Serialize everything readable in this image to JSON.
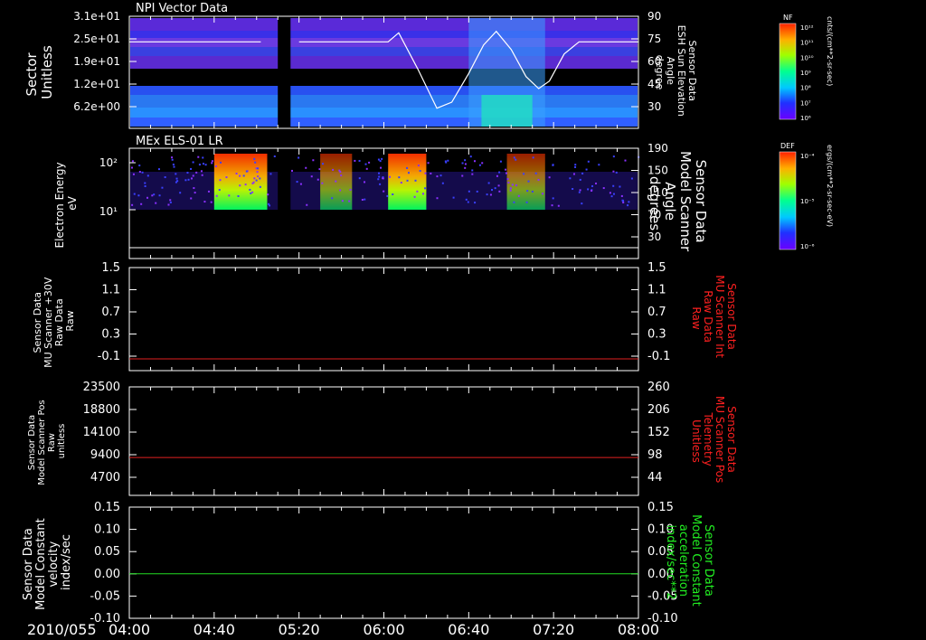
{
  "time_axis": {
    "date_label": "2010/055",
    "tick_labels": [
      "04:00",
      "04:40",
      "05:20",
      "06:00",
      "06:40",
      "07:20",
      "08:00"
    ],
    "range_minutes": [
      240,
      480
    ]
  },
  "panels": [
    {
      "id": "npi",
      "title": "NPI Vector Data",
      "left_label": [
        "Sector",
        "Unitless"
      ],
      "right_label": [
        "Sensor Data",
        "ESH Sun Elevation",
        "Angle",
        "degree"
      ],
      "left_ticks": [
        "3.1e+01",
        "2.5e+01",
        "1.9e+01",
        "1.2e+01",
        "6.2e+00"
      ],
      "right_ticks": [
        "90",
        "75",
        "60",
        "45",
        "30"
      ]
    },
    {
      "id": "els",
      "title": "MEx ELS-01 LR",
      "left_label": [
        "Electron Energy",
        "eV"
      ],
      "right_label": [
        "Sensor Data",
        "Model Scanner",
        "Angle",
        "degrees"
      ],
      "left_ticks": [
        "10²",
        "10¹"
      ],
      "right_ticks": [
        "190",
        "150",
        "110",
        "70",
        "30"
      ]
    },
    {
      "id": "scanner-int",
      "title": "",
      "left_label": [
        "Sensor Data",
        "MU Scanner +30V",
        "Raw Data",
        "Raw"
      ],
      "right_label": [
        "Sensor Data",
        "MU Scanner Int",
        "Raw Data",
        "Raw"
      ],
      "left_ticks": [
        "1.5",
        "1.1",
        "0.7",
        "0.3",
        "-0.1"
      ],
      "right_ticks": [
        "1.5",
        "1.1",
        "0.7",
        "0.3",
        "-0.1"
      ]
    },
    {
      "id": "scanner-pos",
      "title": "",
      "left_label": [
        "Sensor Data",
        "Model Scanner Pos",
        "Raw",
        "unitless"
      ],
      "right_label": [
        "Sensor Data",
        "MU Scanner Pos",
        "Telemetry",
        "Unitless"
      ],
      "left_ticks": [
        "23500",
        "18800",
        "14100",
        "9400",
        "4700"
      ],
      "right_ticks": [
        "260",
        "206",
        "152",
        "98",
        "44"
      ]
    },
    {
      "id": "velocity",
      "title": "",
      "left_label": [
        "Sensor Data",
        "Model Constant",
        "velocity",
        "index/sec"
      ],
      "right_label": [
        "Sensor Data",
        "Model Constant",
        "acceleration",
        "index/sec**2"
      ],
      "left_ticks": [
        "0.15",
        "0.10",
        "0.05",
        "0.00",
        "-0.05",
        "-0.10"
      ],
      "right_ticks": [
        "0.15",
        "0.10",
        "0.05",
        "0.00",
        "-0.05",
        "-0.10"
      ]
    }
  ],
  "colorbars": [
    {
      "id": "nf",
      "title": "NF",
      "unit": "cnts/(cm**2-sr-sec)",
      "ticks": [
        "10¹²",
        "10¹¹",
        "10¹⁰",
        "10⁹",
        "10⁸",
        "10⁷",
        "10⁶"
      ]
    },
    {
      "id": "def",
      "title": "DEF",
      "unit": "ergs/(cm**2-sr-sec-eV)",
      "ticks": [
        "10⁻⁴",
        "10⁻⁵",
        "10⁻⁶"
      ]
    }
  ],
  "colors": {
    "red_line": "#e02020",
    "green_line": "#22dd22",
    "white_line": "#ffffff",
    "right_label_red": "#ff2020",
    "right_label_green": "#22ee22"
  },
  "chart_data": [
    {
      "type": "heatmap",
      "title": "NPI Vector Data",
      "ylabel": "Sector Unitless",
      "yticks": [
        31,
        25,
        19,
        12,
        6.2
      ],
      "overlay_line": {
        "name": "ESH Sun Elevation Angle",
        "axis_range": [
          15,
          90
        ],
        "x_minutes": [
          240,
          302,
          304,
          308,
          314,
          318,
          320,
          322,
          362,
          367,
          376,
          385,
          392,
          400,
          407,
          413,
          420,
          427,
          433,
          438,
          445,
          452,
          460,
          480
        ],
        "y_degree": [
          73,
          73,
          null,
          null,
          null,
          null,
          73,
          73,
          73,
          79,
          55,
          29,
          33,
          52,
          71,
          80,
          68,
          50,
          42,
          47,
          65,
          73,
          73,
          73
        ]
      },
      "data_gap_minutes": [
        310,
        316
      ]
    },
    {
      "type": "heatmap",
      "title": "MEx ELS-01 LR",
      "ylabel": "Electron Energy eV",
      "ylog": true,
      "yticks": [
        100,
        10
      ],
      "bursts_minutes": [
        [
          280,
          305
        ],
        [
          330,
          345
        ],
        [
          362,
          380
        ],
        [
          418,
          436
        ]
      ],
      "overlay_line": {
        "name": "Model Scanner Angle",
        "axis_range": [
          0,
          190
        ],
        "x_minutes": [
          240,
          480
        ],
        "y_degrees": [
          12,
          12
        ]
      },
      "data_gap_minutes": [
        310,
        316
      ]
    },
    {
      "type": "line",
      "series": [
        {
          "name": "MU Scanner Int Raw Data",
          "x_minutes": [
            240,
            480
          ],
          "values": [
            -0.05,
            -0.05
          ]
        }
      ],
      "ylim": [
        -0.25,
        1.5
      ]
    },
    {
      "type": "line",
      "series": [
        {
          "name": "MU Scanner Pos Telemetry",
          "x_minutes": [
            240,
            480
          ],
          "values": [
            8200,
            8200
          ]
        }
      ],
      "ylim": [
        0,
        23500
      ]
    },
    {
      "type": "line",
      "series": [
        {
          "name": "Model Constant velocity",
          "x_minutes": [
            240,
            480
          ],
          "values": [
            0.0,
            0.0
          ]
        }
      ],
      "ylim": [
        -0.1,
        0.15
      ]
    }
  ]
}
